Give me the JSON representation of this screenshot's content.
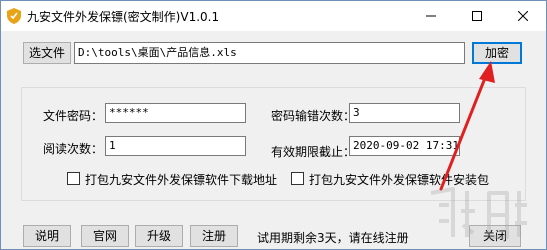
{
  "window": {
    "title": "九安文件外发保镖(密文制作)V1.0.1",
    "minimize_icon": "minimize-icon",
    "maximize_icon": "maximize-icon",
    "close_icon": "close-icon"
  },
  "file": {
    "select_button": "选文件",
    "path_value": "D:\\tools\\桌面\\产品信息.xls",
    "encrypt_button": "加密"
  },
  "form": {
    "password_label": "文件密码：",
    "password_value": "******",
    "wrong_count_label": "密码输错次数：",
    "wrong_count_value": "3",
    "read_count_label": "阅读次数：",
    "read_count_value": "1",
    "expiry_label": "有效期限截止：",
    "expiry_value": "2020-09-02 17:31",
    "pack_download_label": "打包九安文件外发保镖软件下载地址",
    "pack_download_checked": false,
    "pack_installer_label": "打包九安文件外发保镖软件安装包",
    "pack_installer_checked": false
  },
  "footer": {
    "help_button": "说明",
    "website_button": "官网",
    "upgrade_button": "升级",
    "register_button": "注册",
    "status_text": "试用期剩余3天，请在线注册",
    "close_button": "关闭"
  },
  "colors": {
    "annotation_arrow": "#e02020",
    "focus_border": "#0078d7",
    "window_border": "#6d8fb8"
  }
}
